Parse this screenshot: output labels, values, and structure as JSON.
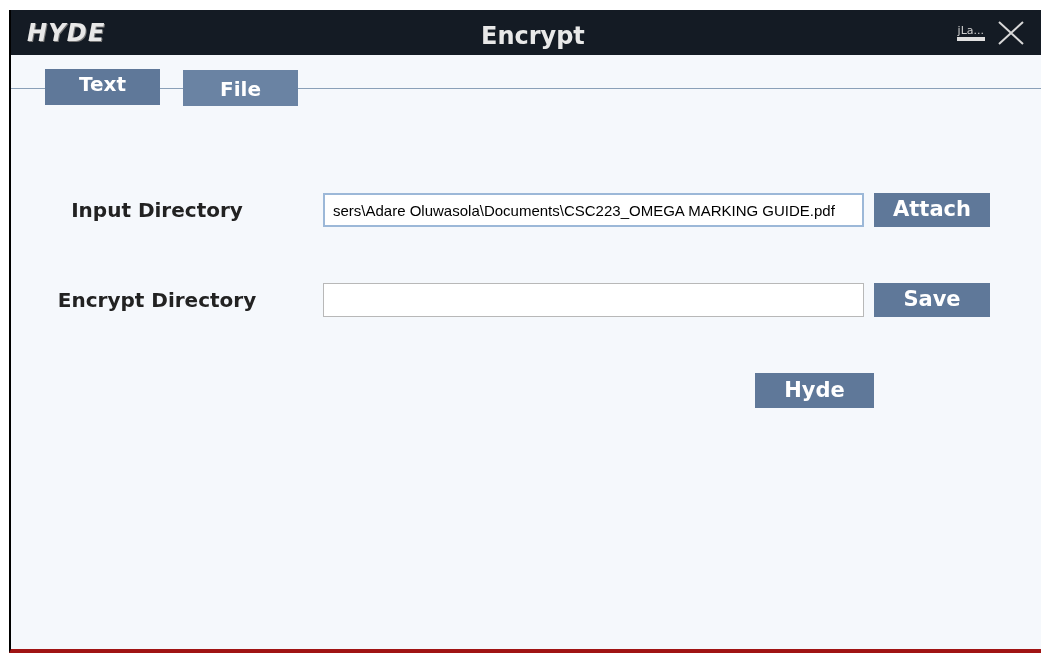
{
  "window": {
    "logo": "HYDE",
    "title": "Encrypt",
    "minimize_label": "jLa..."
  },
  "tabs": [
    {
      "label": "Text",
      "selected": true
    },
    {
      "label": "File",
      "selected": false
    }
  ],
  "form": {
    "rows": [
      {
        "label": "Input Directory",
        "value": "sers\\Adare Oluwasola\\Documents\\CSC223_OMEGA MARKING GUIDE.pdf",
        "focused": true,
        "button": "Attach"
      },
      {
        "label": "Encrypt Directory",
        "value": "",
        "focused": false,
        "button": "Save"
      }
    ],
    "submit": "Hyde"
  }
}
